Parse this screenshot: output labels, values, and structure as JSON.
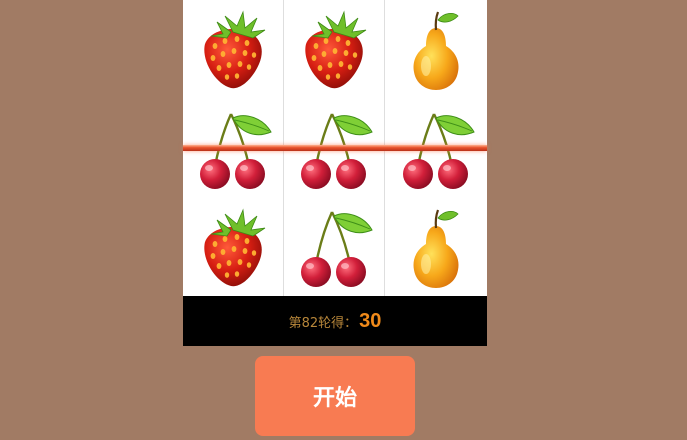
{
  "reels": [
    [
      "strawberry",
      "cherry",
      "strawberry"
    ],
    [
      "strawberry",
      "cherry",
      "cherry"
    ],
    [
      "pear",
      "cherry",
      "pear"
    ]
  ],
  "score": {
    "label": "第82轮得：",
    "value": "30"
  },
  "start_button": {
    "label": "开始"
  },
  "colors": {
    "background": "#a17b64",
    "start_button": "#f87b52",
    "score_value": "#f08a1a",
    "payline": "#e8502a"
  }
}
